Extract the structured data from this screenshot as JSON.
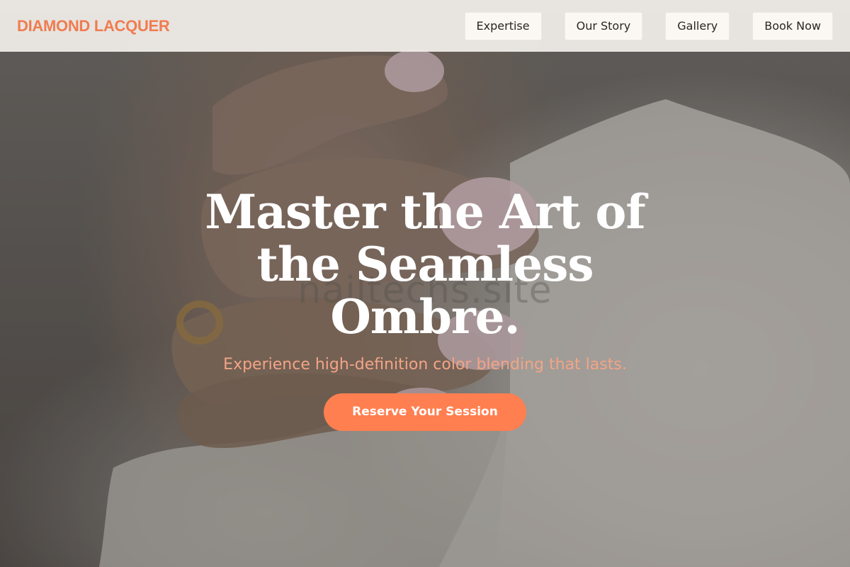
{
  "header": {
    "brand": "DIAMOND LACQUER",
    "nav": [
      {
        "label": "Expertise"
      },
      {
        "label": "Our Story"
      },
      {
        "label": "Gallery"
      },
      {
        "label": "Book Now"
      }
    ]
  },
  "hero": {
    "title": "Master the Art of the Seamless Ombre.",
    "subtitle": "Experience high-definition color blending that lasts.",
    "cta_label": "Reserve Your Session",
    "watermark": "nailtechs.site",
    "background_image": "hand with pink ombre almond nails gripping white fabric"
  },
  "colors": {
    "brand": "#f07c50",
    "cta": "#ff7f50",
    "subtitle": "#f4a486",
    "header_bg": "#f2efeb"
  }
}
